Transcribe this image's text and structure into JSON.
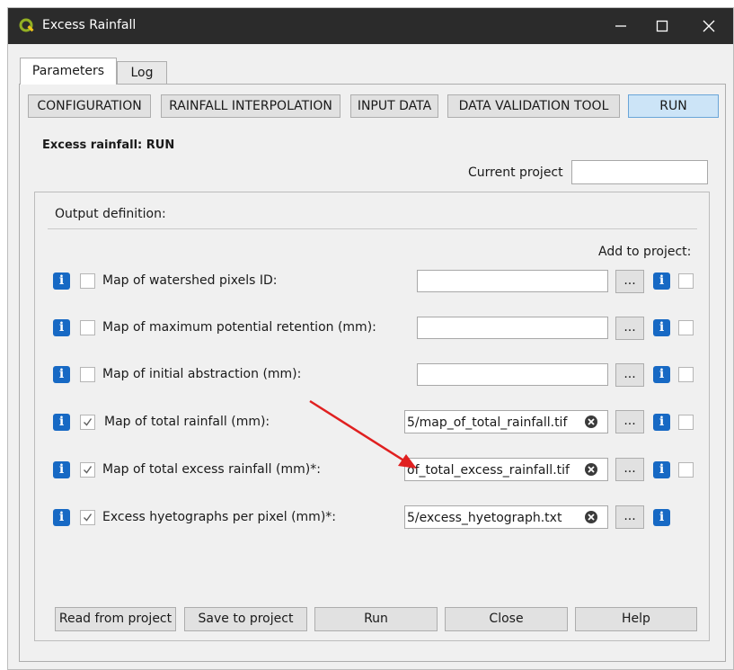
{
  "window": {
    "title": "Excess Rainfall"
  },
  "tabs": [
    {
      "label": "Parameters",
      "active": true
    },
    {
      "label": "Log",
      "active": false
    }
  ],
  "toolbar": [
    {
      "label": "CONFIGURATION",
      "selected": false
    },
    {
      "label": "RAINFALL INTERPOLATION",
      "selected": false
    },
    {
      "label": "INPUT DATA",
      "selected": false
    },
    {
      "label": "DATA VALIDATION TOOL",
      "selected": false
    },
    {
      "label": "RUN",
      "selected": true
    }
  ],
  "section_title": "Excess rainfall: RUN",
  "project": {
    "label": "Current project",
    "value": ""
  },
  "output": {
    "group_title": "Output definition:",
    "add_to_project_label": "Add to project:",
    "browse_label": "...",
    "info_glyph": "i",
    "rows": [
      {
        "label": "Map of watershed pixels ID:",
        "value": "",
        "checked": false,
        "add_to_project": false,
        "has_add_checkbox": true
      },
      {
        "label": "Map of maximum potential retention (mm):",
        "value": "",
        "checked": false,
        "add_to_project": false,
        "has_add_checkbox": true
      },
      {
        "label": "Map of initial abstraction (mm):",
        "value": "",
        "checked": false,
        "add_to_project": false,
        "has_add_checkbox": true
      },
      {
        "label": "Map of total rainfall (mm):",
        "value": "5/map_of_total_rainfall.tif",
        "checked": true,
        "add_to_project": false,
        "has_add_checkbox": true
      },
      {
        "label": "Map of total excess rainfall (mm)*:",
        "value": "of_total_excess_rainfall.tif",
        "checked": true,
        "add_to_project": false,
        "has_add_checkbox": true
      },
      {
        "label": "Excess hyetographs per pixel (mm)*:",
        "value": "5/excess_hyetograph.txt",
        "checked": true,
        "add_to_project": false,
        "has_add_checkbox": false
      }
    ]
  },
  "footer": [
    {
      "label": "Read from project"
    },
    {
      "label": "Save to project"
    },
    {
      "label": "Run"
    },
    {
      "label": "Close"
    },
    {
      "label": "Help"
    }
  ],
  "colors": {
    "accent": "#1769c4",
    "arrow": "#e02020",
    "titlebar": "#2b2b2b",
    "selected_button": "#cce4f7"
  },
  "icons": {
    "app": "qgis-logo-icon",
    "info": "info-icon",
    "clear": "clear-icon",
    "checkbox": "checkmark-icon",
    "annotation": "red-arrow-icon",
    "minimize": "minimize-icon",
    "maximize": "maximize-icon",
    "close": "close-icon"
  }
}
